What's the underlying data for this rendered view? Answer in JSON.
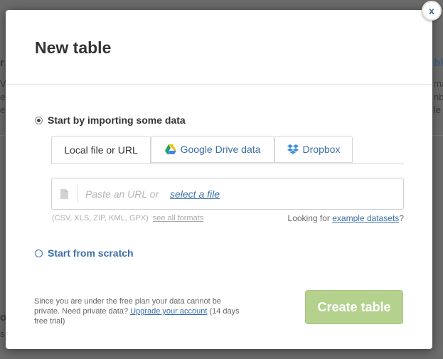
{
  "background": {
    "fragments_left": [
      "r",
      "V,",
      "e",
      "e"
    ],
    "fragments_right": [
      "bli",
      "ma",
      "nb",
      "le"
    ],
    "fragments_bottom": [
      "o",
      "s"
    ]
  },
  "modal": {
    "close_label": "x",
    "title": "New table",
    "option_import": "Start by importing some data",
    "tabs": [
      {
        "label": "Local file or URL",
        "icon": "none"
      },
      {
        "label": "Google Drive data",
        "icon": "google-drive-icon"
      },
      {
        "label": "Dropbox",
        "icon": "dropbox-icon"
      }
    ],
    "url_input": {
      "placeholder": "Paste an URL or",
      "value": ""
    },
    "select_file": "select a file",
    "formats": "(CSV, XLS, ZIP, KML, GPX)",
    "see_all_formats": "see all formats",
    "looking_prefix": "Looking for",
    "example_datasets": "example datasets",
    "looking_suffix": "?",
    "option_scratch": "Start from scratch",
    "footer_note_1": "Since you are under the free plan your data cannot be private. Need private data?",
    "upgrade_link": "Upgrade your account",
    "footer_note_2": "(14 days free trial)",
    "create_button": "Create table"
  },
  "colors": {
    "accent_blue": "#3a6fa8",
    "create_button_bg": "#b4d28e",
    "overlay": "#6b6b6b"
  }
}
